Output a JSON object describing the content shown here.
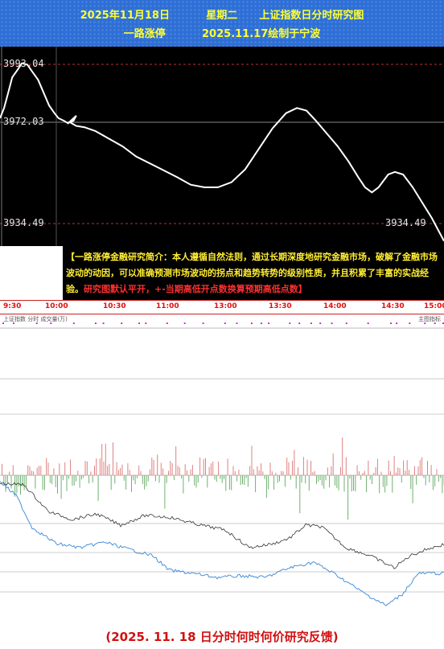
{
  "header": {
    "line1": "2025年11月18日          星期二      上证指数日分时研究图",
    "line2": "一路涨停          2025.11.17绘制于宁波"
  },
  "chart_data": [
    {
      "type": "line",
      "levels": {
        "upper": "3993.04",
        "middle": "3972.03",
        "lower": "3934.49"
      },
      "ylim": [
        3922,
        4000
      ],
      "series": [
        {
          "color": "#ffffff",
          "points": [
            [
              0,
              3972
            ],
            [
              3,
              3976
            ],
            [
              6,
              3982
            ],
            [
              9,
              3988
            ],
            [
              13,
              3991
            ],
            [
              16,
              3993.5
            ],
            [
              20,
              3993
            ],
            [
              24,
              3990
            ],
            [
              28,
              3987
            ],
            [
              32,
              3982
            ],
            [
              36,
              3977
            ],
            [
              40,
              3974
            ],
            [
              43,
              3972
            ],
            [
              47,
              3971
            ],
            [
              50,
              3970
            ],
            [
              53,
              3971.5
            ],
            [
              56,
              3973
            ],
            [
              54,
              3971
            ],
            [
              51,
              3970.5
            ],
            [
              56,
              3969
            ],
            [
              62,
              3968.5
            ],
            [
              70,
              3967
            ],
            [
              80,
              3964
            ],
            [
              90,
              3961
            ],
            [
              100,
              3957
            ],
            [
              115,
              3953
            ],
            [
              130,
              3949
            ],
            [
              140,
              3946
            ],
            [
              150,
              3945
            ],
            [
              160,
              3945
            ],
            [
              170,
              3947
            ],
            [
              180,
              3952
            ],
            [
              190,
              3960
            ],
            [
              200,
              3968
            ],
            [
              210,
              3974
            ],
            [
              218,
              3976
            ],
            [
              225,
              3975
            ],
            [
              232,
              3971
            ],
            [
              240,
              3966
            ],
            [
              248,
              3961
            ],
            [
              256,
              3955
            ],
            [
              263,
              3949
            ],
            [
              268,
              3945
            ],
            [
              273,
              3943
            ],
            [
              278,
              3945
            ],
            [
              285,
              3950
            ],
            [
              290,
              3951
            ],
            [
              296,
              3950
            ],
            [
              303,
              3945
            ],
            [
              310,
              3939
            ],
            [
              317,
              3933
            ],
            [
              322,
              3928
            ],
            [
              326,
              3924
            ]
          ]
        }
      ]
    },
    {
      "type": "bar",
      "series": [
        {
          "name": "",
          "color_up": "#e08080",
          "color_down": "#70b070"
        }
      ]
    }
  ],
  "note": {
    "text_yellow": "【一路涨停金融研究简介：本人遵循自然法则，通过长期深度地研究金融市场，破解了金融市场波动的动因，可以准确预测市场波动的拐点和趋势转势的级别性质，并且积累了丰富的实战经验。",
    "text_red": "研究图默认平开，+-当期高低开点数换算预期高低点数】"
  },
  "time_axis": [
    "9:30",
    "10:00",
    "10:30",
    "11:00",
    "13:00",
    "13:30",
    "14:00",
    "14:30",
    "15:00"
  ],
  "sub_panel": {
    "left_label": "上证指数 分时 成交量(万)",
    "right_label": "主图指标"
  },
  "footer": {
    "text": "(2025. 11. 18 日分时何时何价研究反馈)"
  }
}
